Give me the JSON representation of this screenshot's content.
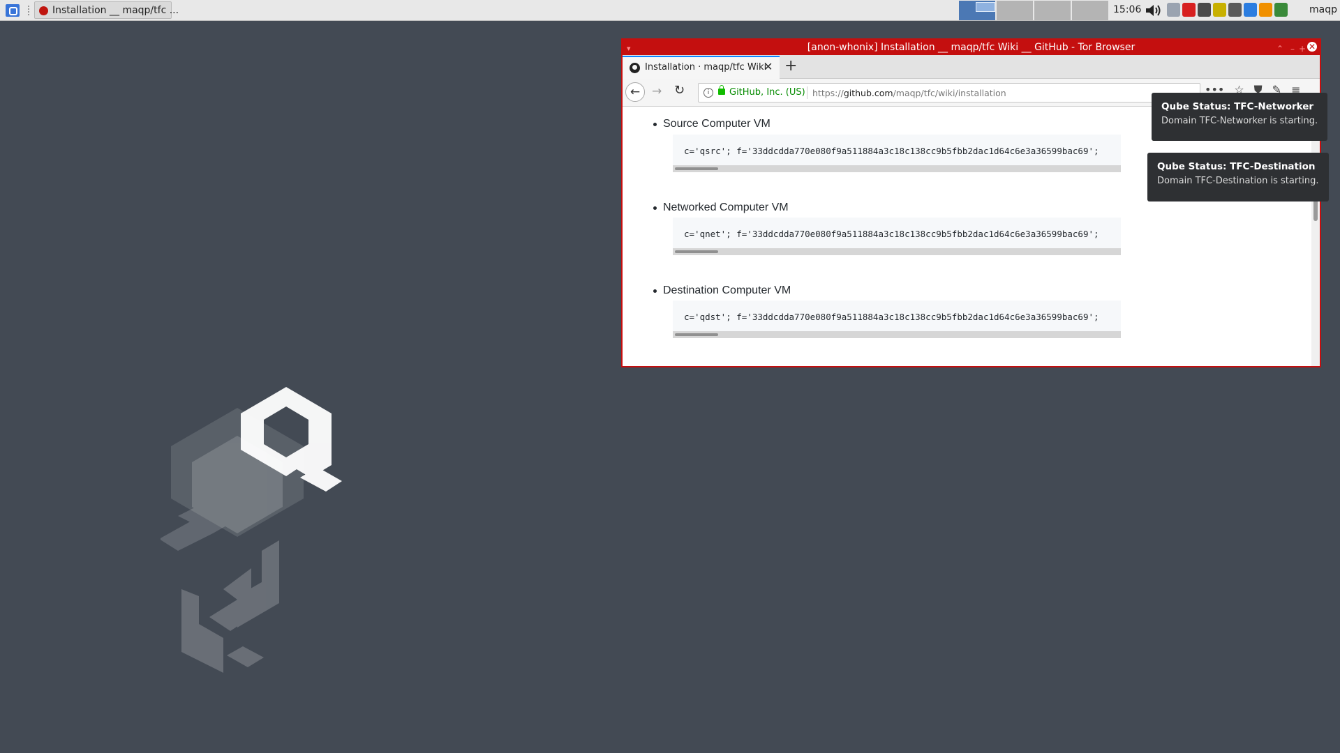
{
  "taskbar": {
    "task_label": "Installation __ maqp/tfc ...",
    "clock": "15:06",
    "user": "maqp",
    "tray_colors": [
      "#9aa3b0",
      "#d72020",
      "#4a4a4a",
      "#c8b000",
      "#5a5a5a",
      "#2b7de0",
      "#f09000",
      "#3a8a3a"
    ]
  },
  "window": {
    "title": "[anon-whonix] Installation __ maqp/tfc Wiki __ GitHub - Tor Browser",
    "border_color": "#c40f0f",
    "tab_label": "Installation · maqp/tfc Wiki",
    "new_tab_symbol": "+",
    "identity_label": "GitHub, Inc. (US)",
    "url_scheme": "https://",
    "url_host": "github.com",
    "url_path": "/maqp/tfc/wiki/installation"
  },
  "content": {
    "sections": [
      {
        "heading": "Source Computer VM",
        "code": "c='qsrc'; f='33ddcdda770e080f9a511884a3c18c138cc9b5fbb2dac1d64c6e3a36599bac69';"
      },
      {
        "heading": "Networked Computer VM",
        "code": "c='qnet'; f='33ddcdda770e080f9a511884a3c18c138cc9b5fbb2dac1d64c6e3a36599bac69';"
      },
      {
        "heading": "Destination Computer VM",
        "code": "c='qdst'; f='33ddcdda770e080f9a511884a3c18c138cc9b5fbb2dac1d64c6e3a36599bac69';"
      }
    ]
  },
  "notifications": [
    {
      "title": "Qube Status: TFC-Networker",
      "body": "Domain TFC-Networker is starting."
    },
    {
      "title": "Qube Status: TFC-Destination",
      "body": "Domain TFC-Destination is starting."
    }
  ]
}
